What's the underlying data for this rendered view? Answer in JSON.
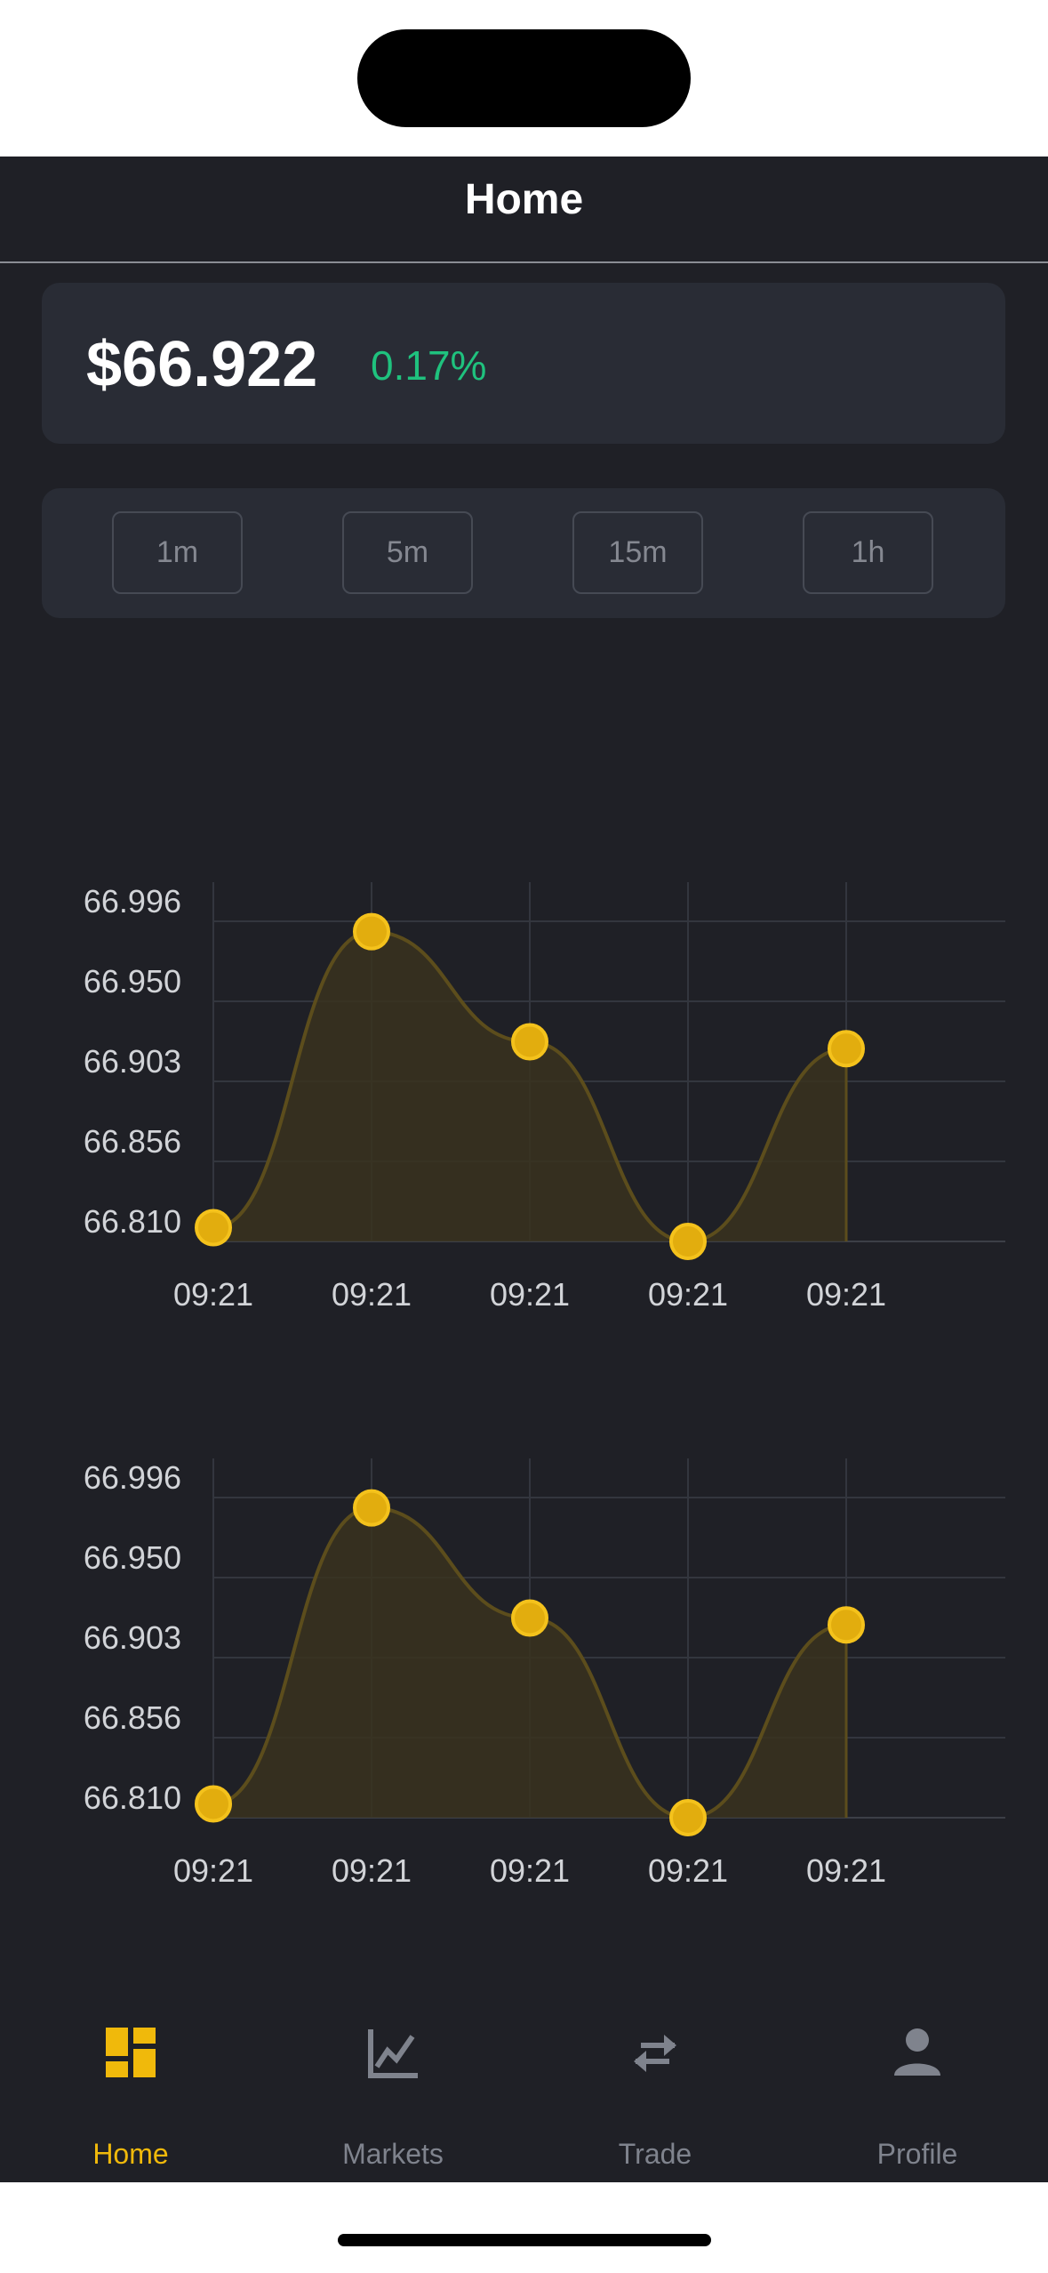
{
  "header": {
    "title": "Home"
  },
  "price": {
    "value": "$66.922",
    "change": "0.17%",
    "change_color": "#1fc27e"
  },
  "timeframes": [
    "1m",
    "5m",
    "15m",
    "1h"
  ],
  "colors": {
    "background": "#1f2026",
    "card": "#292c35",
    "accent": "#f0b90b",
    "inactive": "#7f838d",
    "area_fill": "#3a331f"
  },
  "chart_data": [
    {
      "type": "area",
      "x": [
        "09:21",
        "09:21",
        "09:21",
        "09:21",
        "09:21"
      ],
      "values": [
        66.818,
        66.99,
        66.926,
        66.81,
        66.922
      ],
      "yticks": [
        "66.996",
        "66.950",
        "66.903",
        "66.856",
        "66.810"
      ],
      "ylim": [
        66.81,
        66.996
      ],
      "grid": true,
      "series_color": "#f0b90b"
    },
    {
      "type": "area",
      "x": [
        "09:21",
        "09:21",
        "09:21",
        "09:21",
        "09:21"
      ],
      "values": [
        66.818,
        66.99,
        66.926,
        66.81,
        66.922
      ],
      "yticks": [
        "66.996",
        "66.950",
        "66.903",
        "66.856",
        "66.810"
      ],
      "ylim": [
        66.81,
        66.996
      ],
      "grid": true,
      "series_color": "#f0b90b"
    }
  ],
  "tabbar": {
    "items": [
      {
        "label": "Home",
        "icon": "dashboard-icon",
        "active": true
      },
      {
        "label": "Markets",
        "icon": "line-chart-icon",
        "active": false
      },
      {
        "label": "Trade",
        "icon": "swap-arrows-icon",
        "active": false
      },
      {
        "label": "Profile",
        "icon": "person-icon",
        "active": false
      }
    ]
  }
}
